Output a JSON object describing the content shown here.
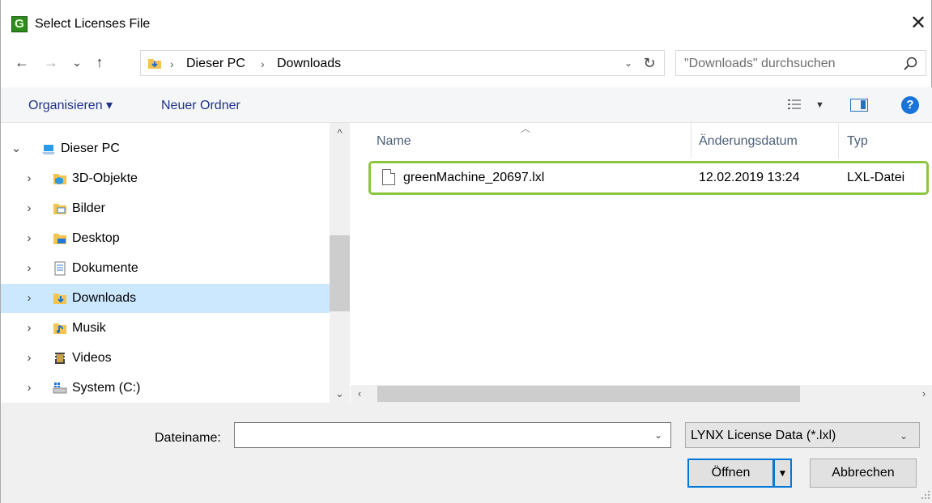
{
  "window": {
    "title": "Select Licenses File",
    "app_icon_letter": "G",
    "close_glyph": "✕"
  },
  "nav": {
    "back": "←",
    "forward": "→",
    "recent": "⌄",
    "up": "↑"
  },
  "address": {
    "breadcrumbs": [
      "Dieser PC",
      "Downloads"
    ],
    "separator": "›",
    "refresh": "↻",
    "dropdown": "⌄"
  },
  "search": {
    "placeholder": "\"Downloads\" durchsuchen"
  },
  "toolbar": {
    "organize_label": "Organisieren ▾",
    "new_folder_label": "Neuer Ordner",
    "help_label": "?"
  },
  "tree": {
    "items": [
      {
        "label": "Dieser PC",
        "expanded": true,
        "icon": "computer-icon"
      },
      {
        "label": "3D-Objekte",
        "icon": "folder-3d-icon"
      },
      {
        "label": "Bilder",
        "icon": "folder-pictures-icon"
      },
      {
        "label": "Desktop",
        "icon": "folder-desktop-icon"
      },
      {
        "label": "Dokumente",
        "icon": "folder-documents-icon"
      },
      {
        "label": "Downloads",
        "icon": "folder-downloads-icon",
        "selected": true
      },
      {
        "label": "Musik",
        "icon": "folder-music-icon"
      },
      {
        "label": "Videos",
        "icon": "folder-videos-icon"
      },
      {
        "label": "System (C:)",
        "icon": "drive-icon"
      }
    ]
  },
  "filelist": {
    "columns": [
      "Name",
      "Änderungsdatum",
      "Typ"
    ],
    "files": [
      {
        "name": "greenMachine_20697.lxl",
        "date": "12.02.2019 13:24",
        "type": "LXL-Datei",
        "highlight_color": "#8cc63f"
      }
    ]
  },
  "footer": {
    "filename_label": "Dateiname:",
    "filename_value": "",
    "filetype_value": "LYNX License Data (*.lxl)",
    "open_label": "Öffnen",
    "cancel_label": "Abbrechen"
  },
  "colors": {
    "accent": "#0078d7",
    "selection": "#cce8ff",
    "highlight": "#8cc63f",
    "link_text": "#1e3287"
  }
}
